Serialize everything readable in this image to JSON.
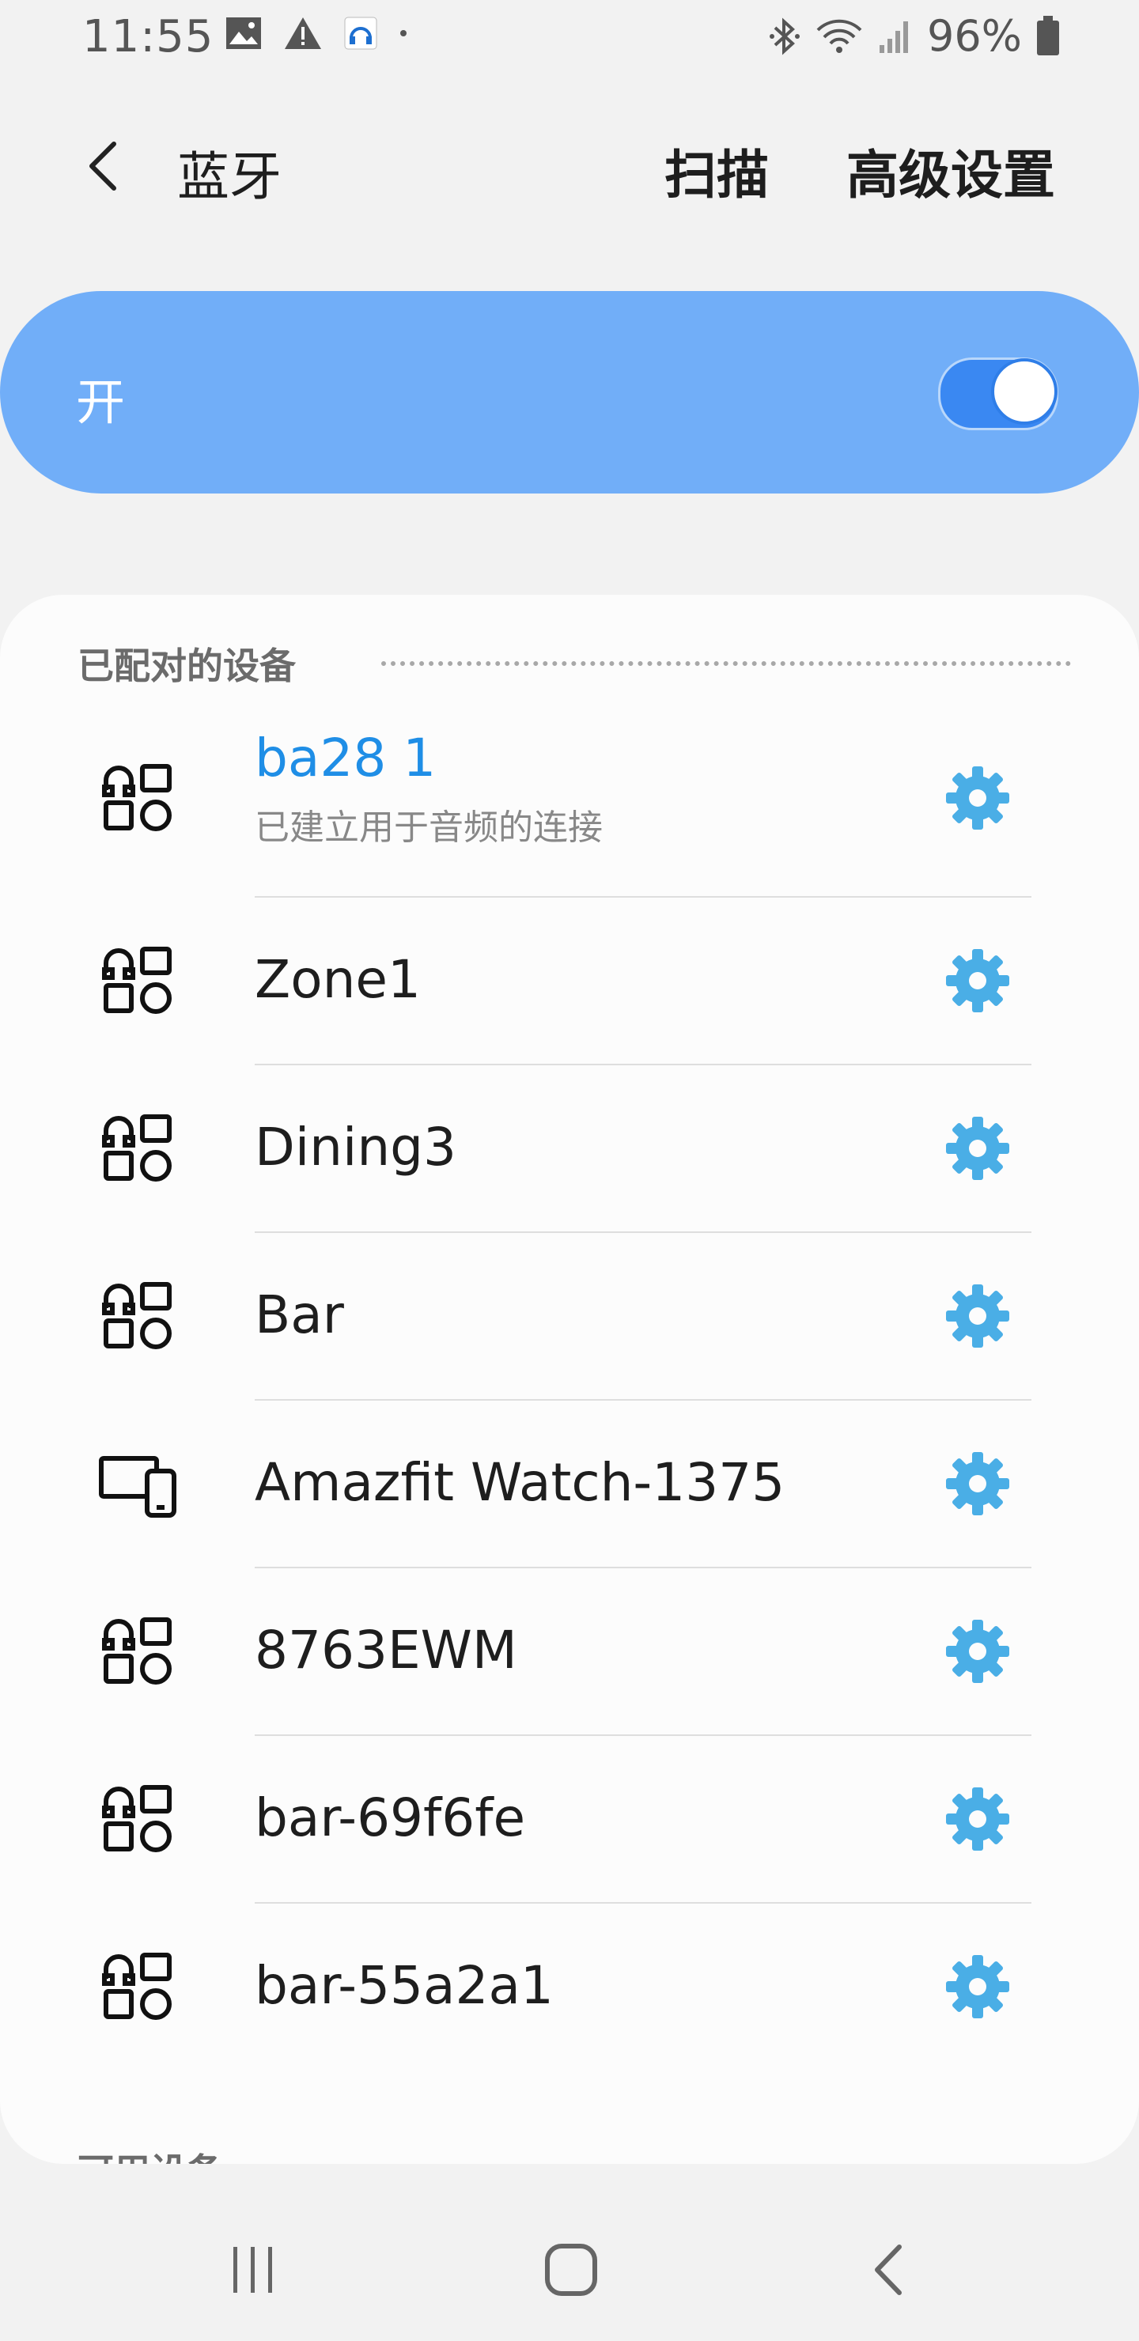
{
  "status_bar": {
    "time": "11:55",
    "battery_percent": "96%",
    "icons": [
      "image-icon",
      "warning-icon",
      "headset-app-icon",
      "dot-icon",
      "bluetooth-icon",
      "wifi-icon",
      "signal-icon",
      "battery-icon"
    ]
  },
  "header": {
    "title": "蓝牙",
    "scan_label": "扫描",
    "advanced_label": "高级设置"
  },
  "toggle": {
    "label": "开",
    "on": true,
    "accent": "#71aef8"
  },
  "paired": {
    "heading": "已配对的设备",
    "devices": [
      {
        "name": "ba28 1",
        "status": "已建立用于音频的连接",
        "icon": "headphones-icon",
        "connected": true
      },
      {
        "name": "Zone1",
        "status": "",
        "icon": "headphones-icon",
        "connected": false
      },
      {
        "name": "Dining3",
        "status": "",
        "icon": "headphones-icon",
        "connected": false
      },
      {
        "name": "Bar",
        "status": "",
        "icon": "headphones-icon",
        "connected": false
      },
      {
        "name": "Amazfit Watch-1375",
        "status": "",
        "icon": "devices-icon",
        "connected": false
      },
      {
        "name": "8763EWM",
        "status": "",
        "icon": "headphones-icon",
        "connected": false
      },
      {
        "name": "bar-69f6fe",
        "status": "",
        "icon": "headphones-icon",
        "connected": false
      },
      {
        "name": "bar-55a2a1",
        "status": "",
        "icon": "headphones-icon",
        "connected": false
      }
    ]
  },
  "available": {
    "heading": "可用设备"
  },
  "colors": {
    "connected_text": "#1f8ee6",
    "gear": "#4aaee6"
  },
  "navbar": {
    "buttons": [
      "recents-icon",
      "home-icon",
      "back-icon"
    ]
  }
}
